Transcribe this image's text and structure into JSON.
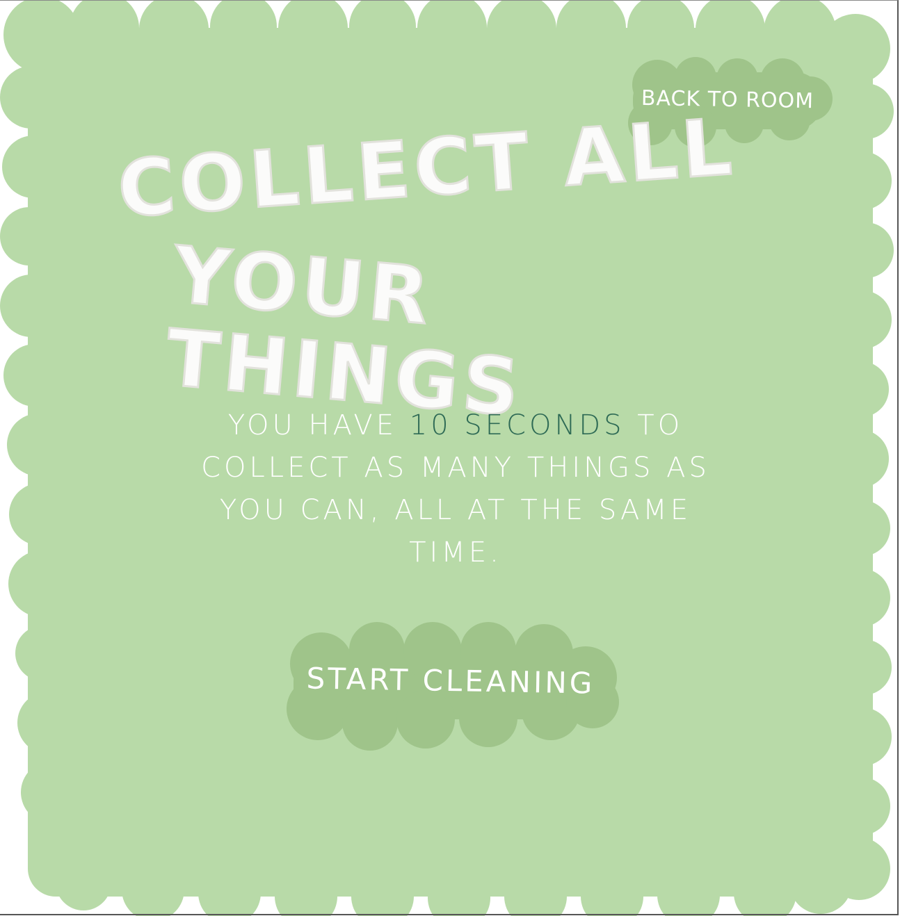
{
  "colors": {
    "background": "#ffffff",
    "cloud": "#b8daa8",
    "button": "#9fc48a",
    "text": "#ffffff",
    "highlight": "#2e6a55"
  },
  "nav": {
    "back_label": "BACK TO ROOM"
  },
  "title": {
    "line1": "COLLECT  ALL",
    "line2": "YOUR THINGS"
  },
  "instructions": {
    "before": "YOU HAVE ",
    "highlight": "10 SECONDS",
    "after": " TO COLLECT AS MANY THINGS AS YOU CAN, ALL AT THE SAME TIME."
  },
  "actions": {
    "start_label": "START CLEANING"
  }
}
